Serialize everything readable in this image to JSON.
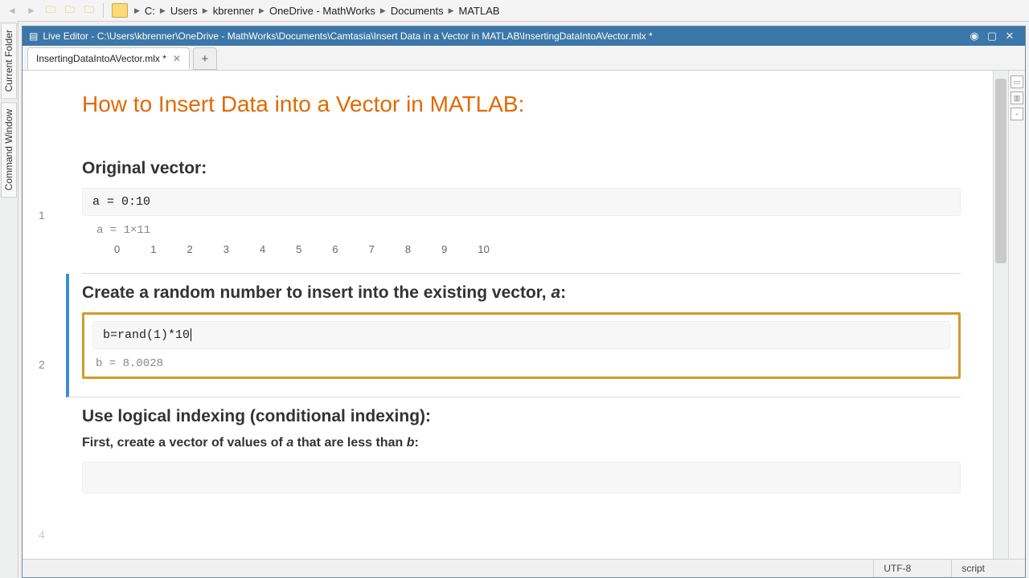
{
  "breadcrumb": {
    "parts": [
      "C:",
      "Users",
      "kbrenner",
      "OneDrive - MathWorks",
      "Documents",
      "MATLAB"
    ]
  },
  "leftTabs": {
    "top": "Current Folder",
    "bottom": "Command Window"
  },
  "editor": {
    "windowTitle": "Live Editor - C:\\Users\\kbrenner\\OneDrive - MathWorks\\Documents\\Camtasia\\Insert Data in a Vector in MATLAB\\InsertingDataIntoAVector.mlx *",
    "tabLabel": "InsertingDataIntoAVector.mlx *"
  },
  "doc": {
    "title": "How to Insert Data into a Vector in MATLAB:",
    "section1": {
      "heading": "Original vector:",
      "code": "a = 0:10",
      "outHead": "a = 1×11",
      "outVals": [
        "0",
        "1",
        "2",
        "3",
        "4",
        "5",
        "6",
        "7",
        "8",
        "9",
        "10"
      ],
      "lineNo": "1"
    },
    "section2": {
      "headingPrefix": "Create a random number to insert into the existing vector, ",
      "headingVar": "a",
      "headingSuffix": ":",
      "code": "b=rand(1)*10",
      "out": "b = 8.0028",
      "lineNo": "2"
    },
    "section3": {
      "heading": "Use logical indexing (conditional indexing):",
      "paraPrefix": "First, create a vector of values of ",
      "paraVarA": "a",
      "paraMid": " that are less than ",
      "paraVarB": "b",
      "paraSuffix": ":",
      "lineNo": "4"
    }
  },
  "status": {
    "encoding": "UTF-8",
    "mode": "script"
  }
}
